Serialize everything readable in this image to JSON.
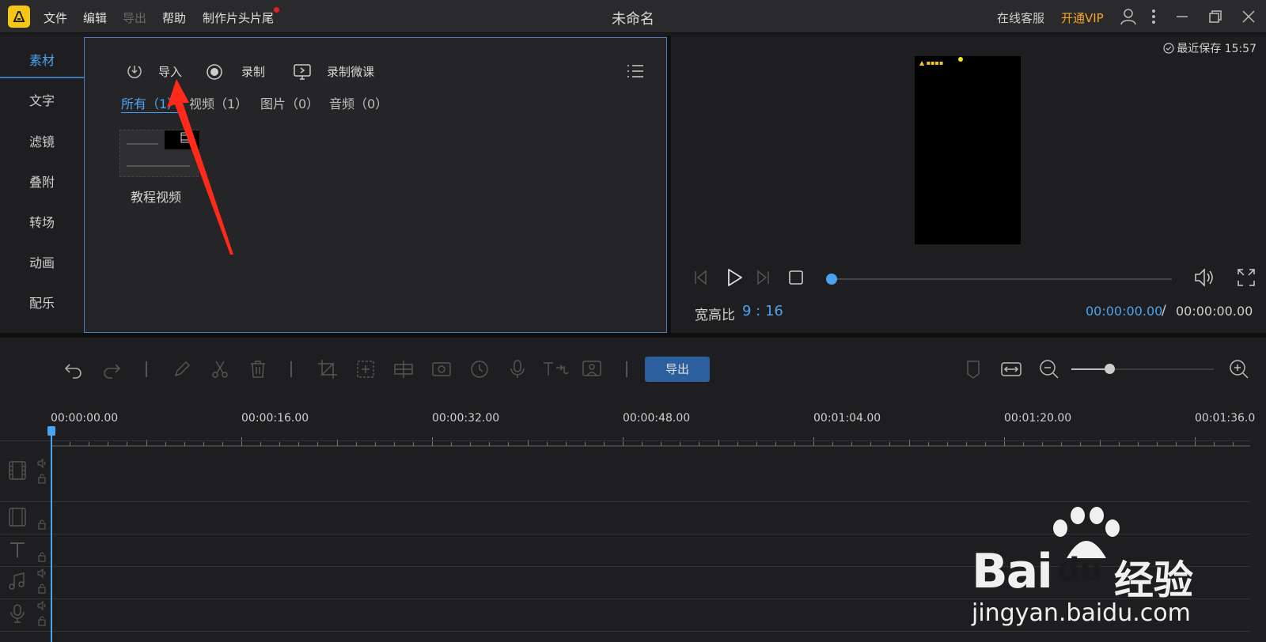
{
  "titlebar": {
    "menus": [
      "文件",
      "编辑",
      "导出",
      "帮助",
      "制作片头片尾"
    ],
    "title": "未命名",
    "support": "在线客服",
    "vip": "开通VIP"
  },
  "sidebar": {
    "items": [
      "素材",
      "文字",
      "滤镜",
      "叠附",
      "转场",
      "动画",
      "配乐"
    ],
    "active_index": 0
  },
  "media": {
    "tools": {
      "import": "导入",
      "record": "录制",
      "record_micro": "录制微课"
    },
    "filters": [
      "所有（1）",
      "视频（1）",
      "图片（0）",
      "音频（0）"
    ],
    "items": [
      {
        "name": "教程视频"
      }
    ]
  },
  "preview": {
    "last_saved": "最近保存 15:57",
    "aspect_label": "宽高比",
    "aspect_value": "9 : 16",
    "time_current": "00:00:00.00",
    "time_sep": "/",
    "time_total": "00:00:00.00",
    "progress": 0
  },
  "toolbar": {
    "export_label": "导出",
    "zoom_level": 0.28
  },
  "timeline": {
    "ruler_labels": [
      "00:00:00.00",
      "00:00:16.00",
      "00:00:32.00",
      "00:00:48.00",
      "00:01:04.00",
      "00:01:20.00",
      "00:01:36.0"
    ]
  },
  "watermark": {
    "brand": "Bai",
    "cn": "经验",
    "url": "jingyan.baidu.com"
  },
  "colors": {
    "accent": "#4aa3f0",
    "vip": "#f5a623",
    "export_button": "#2c5f9e",
    "panel_border": "#4f7fb8"
  }
}
